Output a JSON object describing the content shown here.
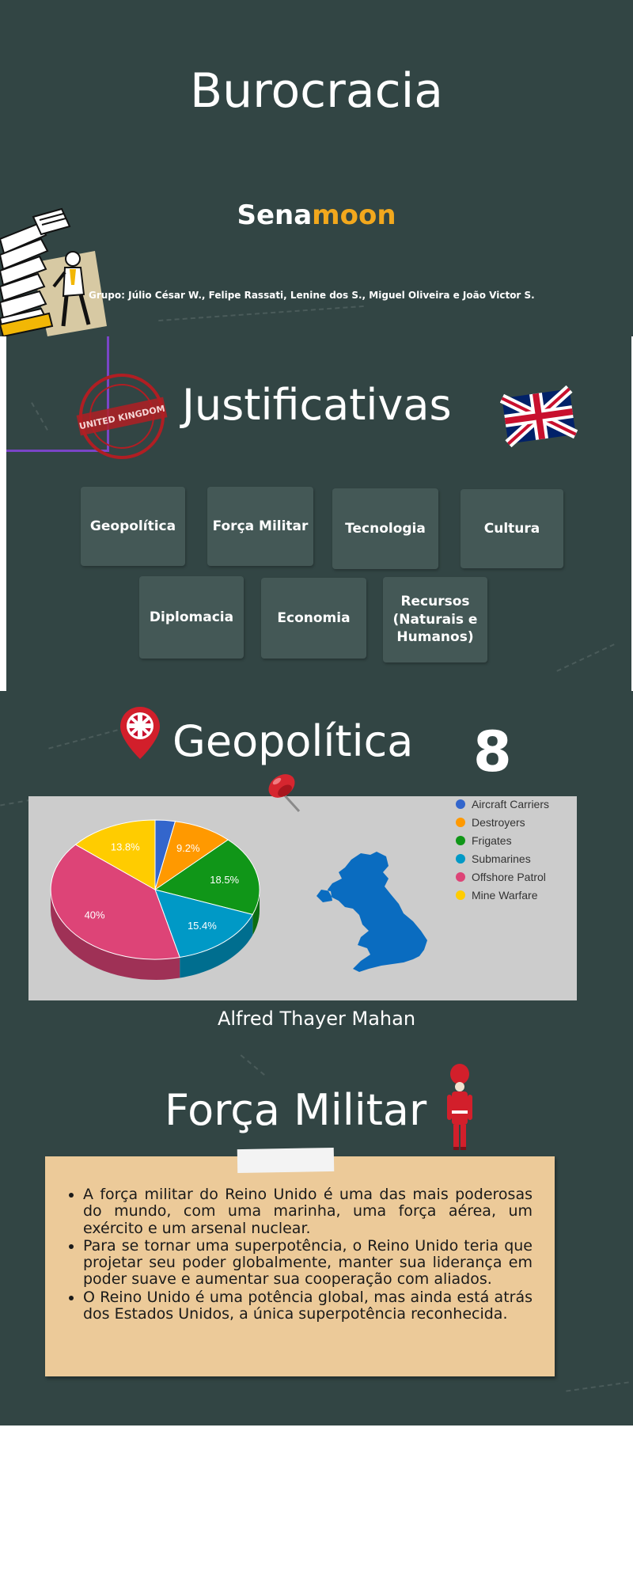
{
  "slide1": {
    "title": "Burocracia",
    "brand_part1": "Sena",
    "brand_part2": "moon",
    "group_line": "Grupo: Júlio César W., Felipe Rassati, Lenine dos S., Miguel Oliveira e João Victor S."
  },
  "slide2": {
    "title": "Justificativas",
    "topics": [
      {
        "label": "Geopolítica"
      },
      {
        "label": "Força Militar"
      },
      {
        "label": "Tecnologia"
      },
      {
        "label": "Cultura"
      },
      {
        "label": "Diplomacia"
      },
      {
        "label": "Economia"
      },
      {
        "label": "Recursos (Naturais e Humanos)"
      }
    ]
  },
  "slide3": {
    "title": "Geopolítica",
    "number": "8",
    "caption": "Alfred Thayer Mahan"
  },
  "slide4": {
    "title": "Força Militar",
    "bullets": [
      "A força militar do Reino Unido é uma das mais poderosas do mundo, com uma marinha, uma força aérea, um exército e um arsenal nuclear.",
      "Para se tornar uma superpotência, o Reino Unido teria que projetar seu poder globalmente, manter sua liderança em poder suave e aumentar sua cooperação com aliados.",
      "O Reino Unido é uma potência global, mas ainda está atrás dos Estados Unidos, a única superpotência reconhecida."
    ]
  },
  "colors": {
    "background": "#324544",
    "brand_accent": "#f2a81d",
    "topic_box": "#445856",
    "note_paper": "#ecca99"
  },
  "chart_data": {
    "type": "pie",
    "categories": [
      "Aircraft Carriers",
      "Destroyers",
      "Frigates",
      "Submarines",
      "Offshore Patrol",
      "Mine Warfare"
    ],
    "values": [
      3.1,
      9.2,
      18.5,
      15.4,
      40,
      13.8
    ],
    "labels": [
      "",
      "9.2%",
      "18.5%",
      "15.4%",
      "40%",
      "13.8%"
    ],
    "colors": [
      "#3366cc",
      "#ff9900",
      "#109618",
      "#0099c6",
      "#dd4477",
      "#ffcc00"
    ],
    "legend_position": "top-right"
  }
}
